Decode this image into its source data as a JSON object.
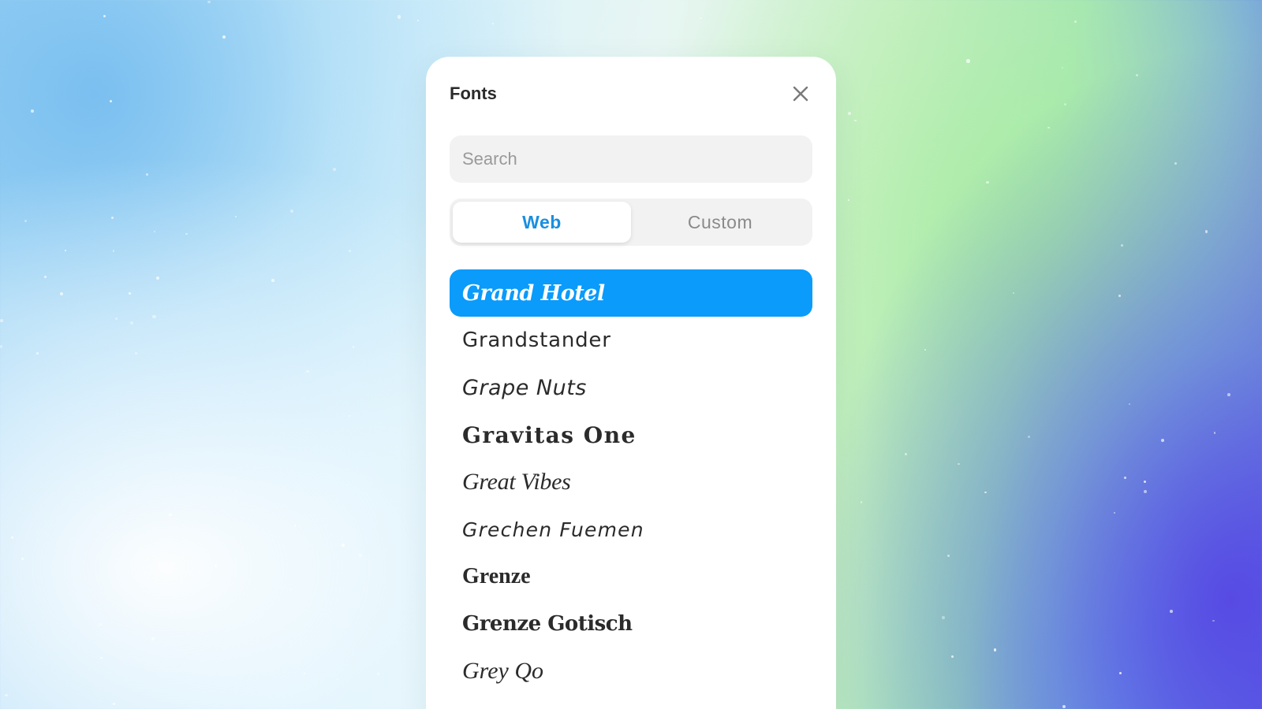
{
  "panel": {
    "title": "Fonts",
    "close_icon": "close-icon"
  },
  "search": {
    "placeholder": "Search",
    "value": ""
  },
  "tabs": [
    {
      "label": "Web",
      "active": true
    },
    {
      "label": "Custom",
      "active": false
    }
  ],
  "fonts": [
    {
      "name": "Grand Hotel",
      "selected": true
    },
    {
      "name": "Grandstander",
      "selected": false
    },
    {
      "name": "Grape Nuts",
      "selected": false
    },
    {
      "name": "Gravitas One",
      "selected": false
    },
    {
      "name": "Great Vibes",
      "selected": false
    },
    {
      "name": "Grechen Fuemen",
      "selected": false
    },
    {
      "name": "Grenze",
      "selected": false
    },
    {
      "name": "Grenze Gotisch",
      "selected": false
    },
    {
      "name": "Grey Qo",
      "selected": false
    }
  ],
  "colors": {
    "accent": "#0a9bfb",
    "tab_active_text": "#1a8fe0",
    "field_background": "#f2f2f2"
  }
}
